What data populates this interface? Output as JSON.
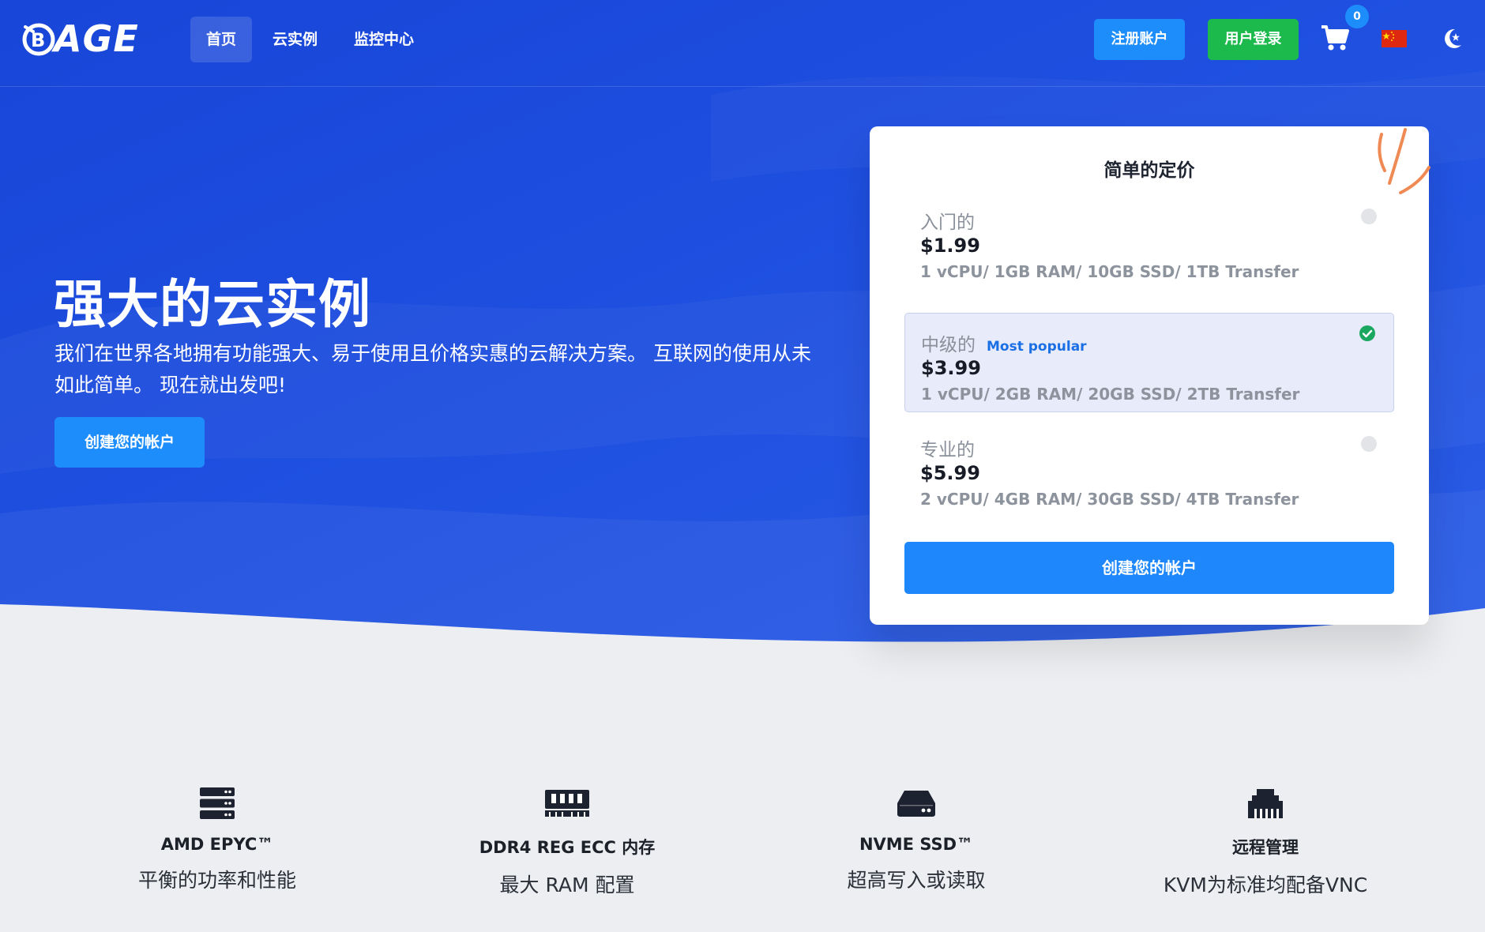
{
  "brand": {
    "logo_text": "AGE"
  },
  "nav": {
    "items": [
      {
        "label": "首页",
        "active": true
      },
      {
        "label": "云实例",
        "active": false
      },
      {
        "label": "监控中心",
        "active": false
      }
    ]
  },
  "header": {
    "register_label": "注册账户",
    "login_label": "用户登录",
    "cart_count": "0",
    "language_flag": "flag-cn-icon",
    "theme_icon": "moon-star-icon"
  },
  "hero": {
    "title": "强大的云实例",
    "description": "我们在世界各地拥有功能强大、易于使用且价格实惠的云解决方案。 互联网的使用从未如此简单。 现在就出发吧!",
    "cta_label": "创建您的帐户"
  },
  "pricing": {
    "title": "简单的定价",
    "plans": [
      {
        "name": "入门的",
        "tag": "",
        "price": "$1.99",
        "specs": "1 vCPU/ 1GB RAM/ 10GB SSD/ 1TB Transfer",
        "selected": false
      },
      {
        "name": "中级的",
        "tag": "Most popular",
        "price": "$3.99",
        "specs": "1 vCPU/ 2GB RAM/ 20GB SSD/ 2TB Transfer",
        "selected": true
      },
      {
        "name": "专业的",
        "tag": "",
        "price": "$5.99",
        "specs": "2 vCPU/ 4GB RAM/ 30GB SSD/ 4TB Transfer",
        "selected": false
      }
    ],
    "cta_label": "创建您的帐户"
  },
  "features": [
    {
      "icon": "server-icon",
      "title": "AMD EPYC™",
      "subtitle": "平衡的功率和性能"
    },
    {
      "icon": "memory-icon",
      "title": "DDR4 REG ECC 内存",
      "subtitle": "最大 RAM 配置"
    },
    {
      "icon": "hdd-icon",
      "title": "NVME SSD™",
      "subtitle": "超高写入或读取"
    },
    {
      "icon": "ethernet-icon",
      "title": "远程管理",
      "subtitle": "KVM为标准均配备VNC"
    }
  ],
  "colors": {
    "hero_blue": "#1f4fe0",
    "accent_blue": "#1d8dfb",
    "login_green": "#1cb94d",
    "page_bg": "#eceef1",
    "selected_plan_bg": "#e8ebfa",
    "check_green": "#1aa760"
  }
}
